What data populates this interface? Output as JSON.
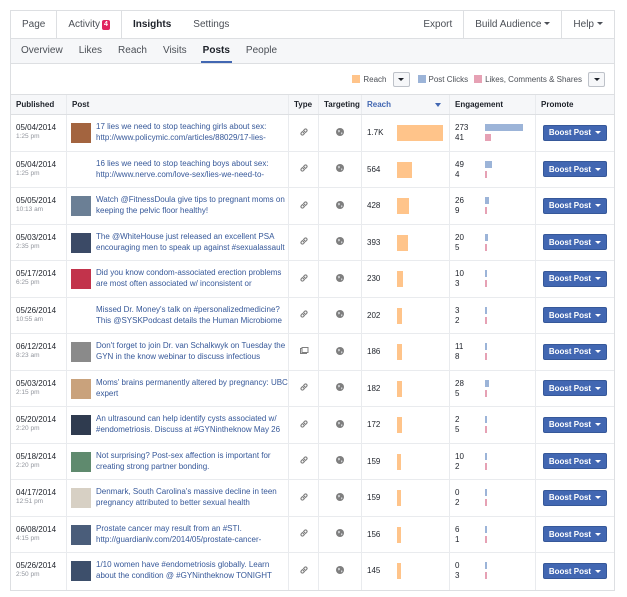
{
  "topnav": {
    "items": [
      {
        "label": "Page"
      },
      {
        "label": "Activity",
        "badge": "4"
      },
      {
        "label": "Insights"
      },
      {
        "label": "Settings"
      }
    ],
    "export": "Export",
    "build_audience": "Build Audience",
    "help": "Help"
  },
  "subnav": {
    "items": [
      "Overview",
      "Likes",
      "Reach",
      "Visits",
      "Posts",
      "People"
    ],
    "active": "Posts"
  },
  "legend": {
    "reach": "Reach",
    "post_clicks": "Post Clicks",
    "likes_comments_shares": "Likes, Comments & Shares",
    "colors": {
      "reach": "#ffc48a",
      "post_clicks": "#9cb4d8",
      "likes_comments_shares": "#e6a1b4"
    }
  },
  "table": {
    "headers": {
      "published": "Published",
      "post": "Post",
      "type": "Type",
      "targeting": "Targeting",
      "reach": "Reach",
      "engagement": "Engagement",
      "promote": "Promote"
    },
    "boost_label": "Boost Post",
    "rows": [
      {
        "date": "05/04/2014",
        "time": "1:25 pm",
        "text": "17 lies we need to stop teaching girls about sex: http://www.policymic.com/articles/88029/17-lies-",
        "type": "link",
        "reach": "1.7K",
        "reach_value": 1700,
        "clicks": "273",
        "likes": "41",
        "thumb": "#a3643f"
      },
      {
        "date": "05/04/2014",
        "time": "1:25 pm",
        "text": "16 lies we need to stop teaching boys about sex: http://www.nerve.com/love-sex/lies-we-need-to-",
        "type": "link",
        "reach": "564",
        "reach_value": 564,
        "clicks": "49",
        "likes": "4",
        "thumb": ""
      },
      {
        "date": "05/05/2014",
        "time": "10:13 am",
        "text": "Watch @FitnessDoula give tips to pregnant moms on keeping the pelvic floor healthy!",
        "type": "link",
        "reach": "428",
        "reach_value": 428,
        "clicks": "26",
        "likes": "9",
        "thumb": "#6b7f95"
      },
      {
        "date": "05/03/2014",
        "time": "2:35 pm",
        "text": "The @WhiteHouse just released an excellent PSA encouraging men to speak up against #sexualassault",
        "type": "link",
        "reach": "393",
        "reach_value": 393,
        "clicks": "20",
        "likes": "5",
        "thumb": "#3b4a66"
      },
      {
        "date": "05/17/2014",
        "time": "6:25 pm",
        "text": "Did you know condom-associated erection problems are most often associated w/ inconsistent or",
        "type": "link",
        "reach": "230",
        "reach_value": 230,
        "clicks": "10",
        "likes": "3",
        "thumb": "#c2334b"
      },
      {
        "date": "05/26/2014",
        "time": "10:55 am",
        "text": "Missed Dr. Money's talk on #personalizedmedicine? This @SYSKPodcast details the Human Microbiome",
        "type": "link",
        "reach": "202",
        "reach_value": 202,
        "clicks": "3",
        "likes": "2",
        "thumb": ""
      },
      {
        "date": "06/12/2014",
        "time": "8:23 am",
        "text": "Don't forget to join Dr. van Schalkwyk on Tuesday the GYN in the know webinar to discuss infectious",
        "type": "event",
        "reach": "186",
        "reach_value": 186,
        "clicks": "11",
        "likes": "8",
        "thumb": "#8a8a8a"
      },
      {
        "date": "05/03/2014",
        "time": "2:15 pm",
        "text": "Moms' brains permanently altered by pregnancy: UBC expert",
        "type": "link",
        "reach": "182",
        "reach_value": 182,
        "clicks": "28",
        "likes": "5",
        "thumb": "#c9a27c"
      },
      {
        "date": "05/20/2014",
        "time": "2:20 pm",
        "text": "An ultrasound can help identify cysts associated w/ #endometriosis. Discuss at #GYNintheknow May 26",
        "type": "link",
        "reach": "172",
        "reach_value": 172,
        "clicks": "2",
        "likes": "5",
        "thumb": "#2f3b4f"
      },
      {
        "date": "05/18/2014",
        "time": "2:20 pm",
        "text": "Not surprising? Post-sex affection is important for creating strong partner bonding.",
        "type": "link",
        "reach": "159",
        "reach_value": 159,
        "clicks": "10",
        "likes": "2",
        "thumb": "#5f8a6e"
      },
      {
        "date": "04/17/2014",
        "time": "12:51 pm",
        "text": "Denmark, South Carolina's massive decline in teen pregnancy attributed to better sexual health",
        "type": "link",
        "reach": "159",
        "reach_value": 159,
        "clicks": "0",
        "likes": "2",
        "thumb": "#d7d0c4"
      },
      {
        "date": "06/08/2014",
        "time": "4:15 pm",
        "text": "Prostate cancer may result from an #STI. http://guardianlv.com/2014/05/prostate-cancer-",
        "type": "link",
        "reach": "156",
        "reach_value": 156,
        "clicks": "6",
        "likes": "1",
        "thumb": "#4a5d7a"
      },
      {
        "date": "05/26/2014",
        "time": "2:50 pm",
        "text": "1/10 women have #endometriosis globally. Learn about the condition @ #GYNintheknow TONIGHT",
        "type": "link",
        "reach": "145",
        "reach_value": 145,
        "clicks": "0",
        "likes": "3",
        "thumb": "#3d4f6b"
      }
    ]
  }
}
